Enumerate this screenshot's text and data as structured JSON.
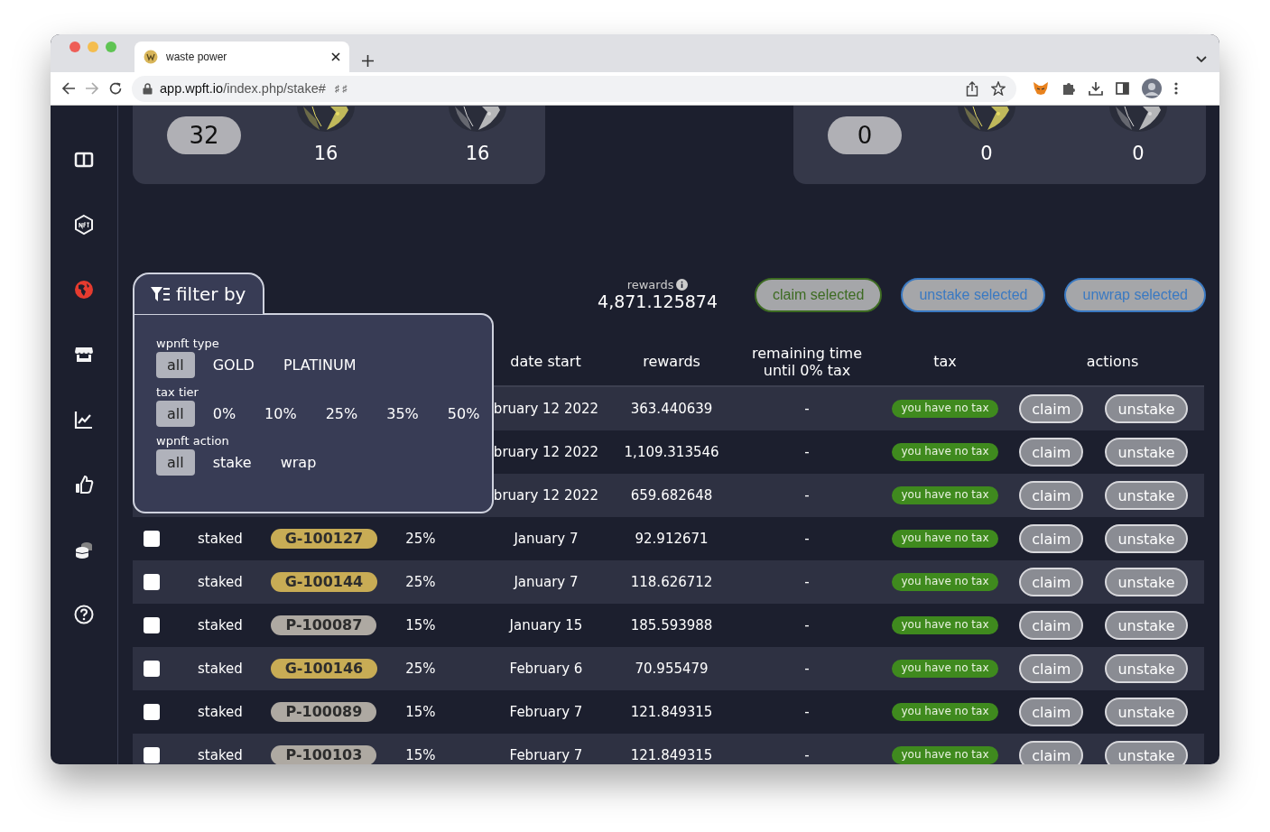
{
  "browser": {
    "tab_title": "waste power",
    "url_host": "app.wpft.io",
    "url_path": "/index.php/stake#",
    "url_suffix": "♯ ♯"
  },
  "sidebar": {
    "items": [
      {
        "kind": "dashboard",
        "selected": false
      },
      {
        "kind": "nft",
        "selected": false
      },
      {
        "kind": "globe",
        "selected": true
      },
      {
        "kind": "shop",
        "selected": false
      },
      {
        "kind": "chart",
        "selected": false
      },
      {
        "kind": "thumb",
        "selected": false
      },
      {
        "kind": "coins",
        "selected": false
      },
      {
        "kind": "help",
        "selected": false
      }
    ]
  },
  "cards": [
    {
      "total": "32",
      "gold": "16",
      "platinum": "16"
    },
    {
      "total": "0",
      "gold": "0",
      "platinum": "0"
    }
  ],
  "filter": {
    "title": "filter by",
    "groups": [
      {
        "label": "wpnft type",
        "options": [
          {
            "label": "all",
            "selected": true
          },
          {
            "label": "GOLD",
            "selected": false
          },
          {
            "label": "PLATINUM",
            "selected": false
          }
        ]
      },
      {
        "label": "tax tier",
        "options": [
          {
            "label": "all",
            "selected": true
          },
          {
            "label": "0%",
            "selected": false
          },
          {
            "label": "10%",
            "selected": false
          },
          {
            "label": "25%",
            "selected": false
          },
          {
            "label": "35%",
            "selected": false
          },
          {
            "label": "50%",
            "selected": false
          }
        ]
      },
      {
        "label": "wpnft action",
        "options": [
          {
            "label": "all",
            "selected": true
          },
          {
            "label": "stake",
            "selected": false
          },
          {
            "label": "wrap",
            "selected": false
          }
        ]
      }
    ]
  },
  "rewards": {
    "label": "rewards",
    "value": "4,871.125874"
  },
  "bulk_actions": [
    {
      "label": "claim selected",
      "kind": "claim"
    },
    {
      "label": "unstake selected",
      "kind": "unstake"
    },
    {
      "label": "unwrap selected",
      "kind": "unwrap"
    }
  ],
  "table": {
    "columns": [
      "date start",
      "rewards",
      "remaining time until 0% tax",
      "tax",
      "actions"
    ],
    "rows": [
      {
        "date": "bruary 12 2022",
        "rewards": "363.440639",
        "remaining": "-",
        "tax": "you have no tax",
        "claim": "claim",
        "unstake": "unstake"
      },
      {
        "date": "bruary 12 2022",
        "rewards": "1,109.313546",
        "remaining": "-",
        "tax": "you have no tax",
        "claim": "claim",
        "unstake": "unstake"
      },
      {
        "date": "bruary 12 2022",
        "rewards": "659.682648",
        "remaining": "-",
        "tax": "you have no tax",
        "claim": "claim",
        "unstake": "unstake"
      },
      {
        "checked": false,
        "status": "staked",
        "id": "G-100127",
        "kind": "gold",
        "apy": "25%",
        "date": "January 7",
        "rewards": "92.912671",
        "remaining": "-",
        "tax": "you have no tax",
        "claim": "claim",
        "unstake": "unstake"
      },
      {
        "checked": false,
        "status": "staked",
        "id": "G-100144",
        "kind": "gold",
        "apy": "25%",
        "date": "January 7",
        "rewards": "118.626712",
        "remaining": "-",
        "tax": "you have no tax",
        "claim": "claim",
        "unstake": "unstake"
      },
      {
        "checked": false,
        "status": "staked",
        "id": "P-100087",
        "kind": "platinum",
        "apy": "15%",
        "date": "January 15",
        "rewards": "185.593988",
        "remaining": "-",
        "tax": "you have no tax",
        "claim": "claim",
        "unstake": "unstake"
      },
      {
        "checked": false,
        "status": "staked",
        "id": "G-100146",
        "kind": "gold",
        "apy": "25%",
        "date": "February 6",
        "rewards": "70.955479",
        "remaining": "-",
        "tax": "you have no tax",
        "claim": "claim",
        "unstake": "unstake"
      },
      {
        "checked": false,
        "status": "staked",
        "id": "P-100089",
        "kind": "platinum",
        "apy": "15%",
        "date": "February 7",
        "rewards": "121.849315",
        "remaining": "-",
        "tax": "you have no tax",
        "claim": "claim",
        "unstake": "unstake"
      },
      {
        "checked": false,
        "status": "staked",
        "id": "P-100103",
        "kind": "platinum",
        "apy": "15%",
        "date": "February 7",
        "rewards": "121.849315",
        "remaining": "-",
        "tax": "you have no tax",
        "claim": "claim",
        "unstake": "unstake"
      }
    ]
  }
}
